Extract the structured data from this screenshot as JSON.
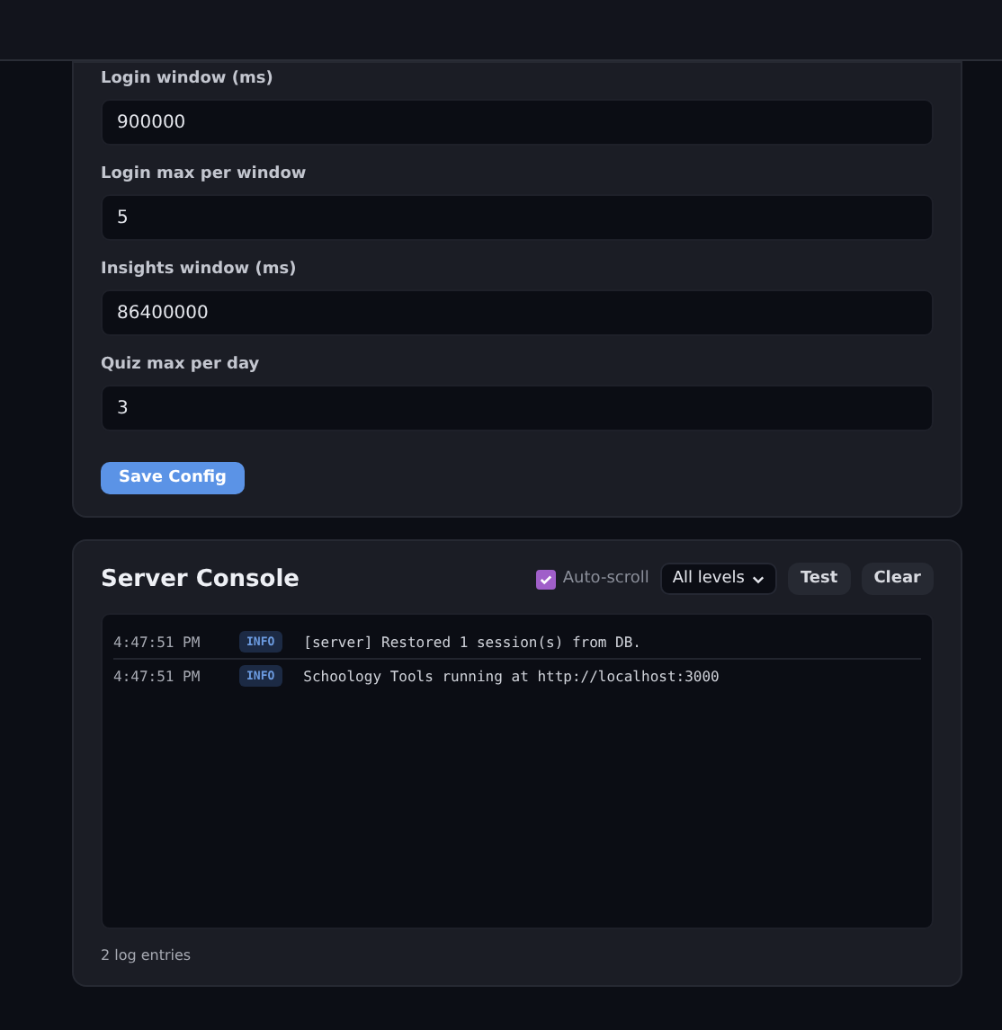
{
  "config": {
    "fields": [
      {
        "label": "Login window (ms)",
        "value": "900000"
      },
      {
        "label": "Login max per window",
        "value": "5"
      },
      {
        "label": "Insights window (ms)",
        "value": "86400000"
      },
      {
        "label": "Quiz max per day",
        "value": "3"
      }
    ],
    "save_button": "Save Config"
  },
  "console": {
    "title": "Server Console",
    "auto_scroll": {
      "label": "Auto-scroll",
      "checked": true
    },
    "level_filter": "All levels",
    "buttons": [
      "Test",
      "Clear"
    ],
    "logs": [
      {
        "time": "4:47:51 PM",
        "level": "INFO",
        "message": "[server] Restored 1 session(s) from DB."
      },
      {
        "time": "4:47:51 PM",
        "level": "INFO",
        "message": "Schoology Tools running at http://localhost:3000"
      }
    ],
    "footer": "2 log entries"
  }
}
